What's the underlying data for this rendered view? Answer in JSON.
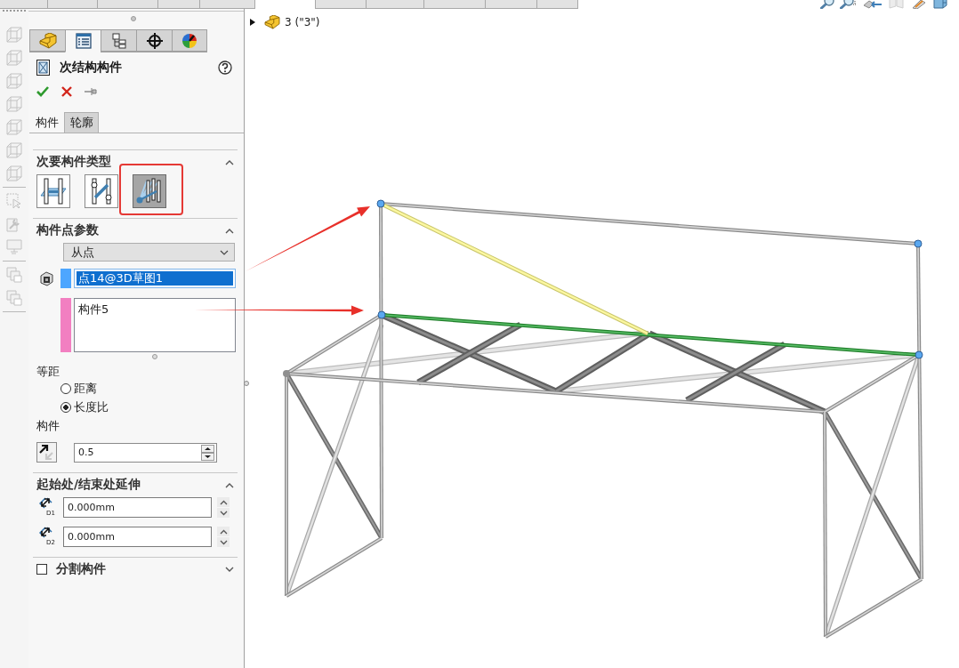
{
  "ribbon_tabs": [
    {
      "selected": false
    },
    {
      "selected": false
    },
    {
      "selected": false
    },
    {
      "selected": false
    },
    {
      "selected": false
    },
    {
      "selected": true
    },
    {
      "selected": false
    },
    {
      "selected": false
    },
    {
      "selected": false
    },
    {
      "selected": false
    },
    {
      "selected": false
    }
  ],
  "left_toolbar": {
    "groups": [
      {
        "items": [
          {
            "kind": "view",
            "disabled": true
          },
          {
            "kind": "view",
            "disabled": true
          },
          {
            "kind": "view",
            "disabled": true
          },
          {
            "kind": "view",
            "disabled": true
          },
          {
            "kind": "view",
            "disabled": true
          },
          {
            "kind": "view",
            "disabled": true
          },
          {
            "kind": "view",
            "disabled": true
          }
        ]
      },
      {
        "items": [
          {
            "kind": "pointer",
            "disabled": true
          },
          {
            "kind": "tool",
            "disabled": true
          },
          {
            "kind": "display",
            "disabled": true
          }
        ]
      },
      {
        "items": [
          {
            "kind": "stack",
            "disabled": true
          },
          {
            "kind": "stack",
            "disabled": true
          }
        ]
      }
    ]
  },
  "panel_tabs": [
    {
      "kind": "part",
      "selected": false
    },
    {
      "kind": "properties",
      "selected": true
    },
    {
      "kind": "config",
      "selected": false
    },
    {
      "kind": "target",
      "selected": false
    },
    {
      "kind": "palette",
      "selected": false
    }
  ],
  "feature": {
    "title": "次结构构件"
  },
  "subtabs": [
    {
      "label": "构件",
      "selected": true
    },
    {
      "label": "轮廓",
      "selected": false
    }
  ],
  "member_type": {
    "title": "次要构件类型",
    "expanded": true,
    "options": [
      {
        "kind": "between",
        "selected": false,
        "marked": false
      },
      {
        "kind": "zigzag",
        "selected": false,
        "marked": false
      },
      {
        "kind": "support",
        "selected": true,
        "marked": true
      }
    ]
  },
  "point_params": {
    "title": "构件点参数",
    "expanded": true,
    "mode": "从点",
    "selections": [
      {
        "kind": "point",
        "color": "#4da6ff",
        "value": "点14@3D草图1",
        "selected": true
      },
      {
        "kind": "members",
        "color": "#f27fc1",
        "value": "构件5",
        "selected": false
      }
    ],
    "offset": {
      "label": "等距",
      "options": [
        {
          "label": "距离",
          "selected": false
        },
        {
          "label": "长度比",
          "selected": true
        }
      ]
    },
    "member": {
      "label": "构件",
      "value": "0.5"
    }
  },
  "extension": {
    "title": "起始处/结束处延伸",
    "expanded": true,
    "fields": [
      {
        "tag": "D1",
        "value": "0.000mm"
      },
      {
        "tag": "D2",
        "value": "0.000mm"
      }
    ]
  },
  "split": {
    "label": "分割构件",
    "checked": false,
    "expanded": false
  },
  "tree": {
    "label": "3 (\"3\")",
    "expanded": false
  }
}
